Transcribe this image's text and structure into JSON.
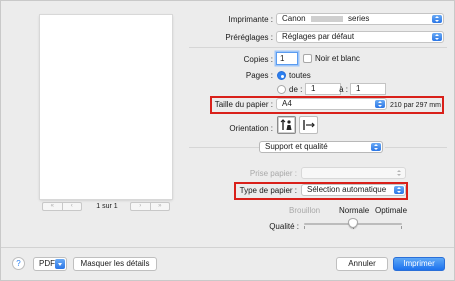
{
  "preview": {
    "page_counter": "1 sur 1"
  },
  "printer": {
    "label": "Imprimante :",
    "value_prefix": "Canon",
    "value_suffix": "series"
  },
  "presets": {
    "label": "Préréglages :",
    "value": "Réglages par défaut"
  },
  "copies": {
    "label": "Copies :",
    "value": "1",
    "bw_label": "Noir et blanc"
  },
  "pages": {
    "label": "Pages :",
    "all_label": "toutes",
    "from_label": "de :",
    "from_value": "1",
    "to_label": "à :",
    "to_value": "1"
  },
  "paper_size": {
    "label": "Taille du papier :",
    "value": "A4",
    "dimensions": "210 par 297 mm"
  },
  "orientation": {
    "label": "Orientation :"
  },
  "section": {
    "value": "Support et qualité"
  },
  "paper_source": {
    "label": "Prise papier :",
    "value": ""
  },
  "media_type": {
    "label": "Type de papier :",
    "value": "Sélection automatique"
  },
  "quality": {
    "label": "Qualité :",
    "draft": "Brouillon",
    "normal": "Normale",
    "optimal": "Optimale",
    "level": 0.5
  },
  "footer": {
    "help": "?",
    "pdf": "PDF",
    "hide_details": "Masquer les détails",
    "cancel": "Annuler",
    "print": "Imprimer"
  },
  "colors": {
    "accent": "#2a7ff0",
    "highlight_border": "#d9201a"
  }
}
